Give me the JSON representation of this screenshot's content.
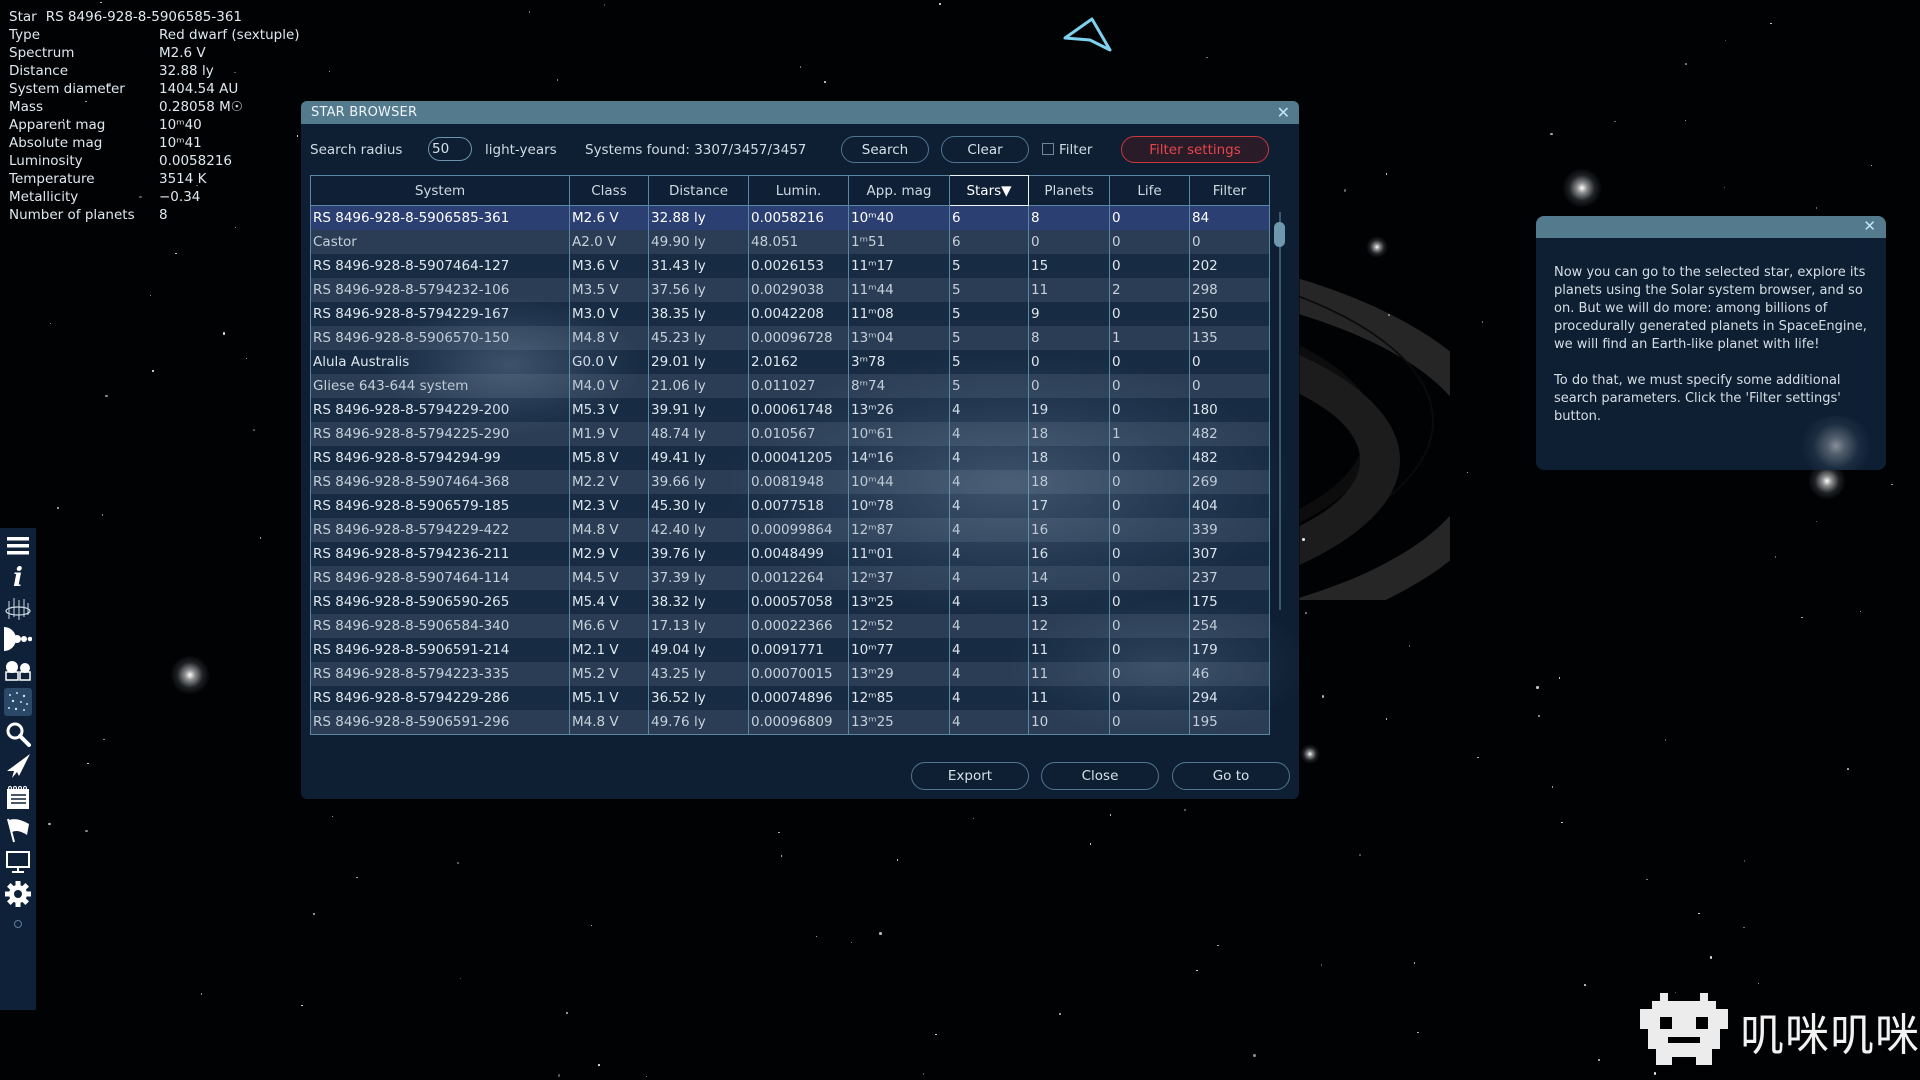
{
  "star_info": {
    "title_label": "Star",
    "title_value": "RS 8496-928-8-5906585-361",
    "rows": [
      {
        "label": "Type",
        "value": "Red dwarf (sextuple)"
      },
      {
        "label": "Spectrum",
        "value": "M2.6 V"
      },
      {
        "label": "Distance",
        "value": "32.88 ly"
      },
      {
        "label": "System diameter",
        "value": "1404.54 AU"
      },
      {
        "label": "Mass",
        "value": "0.28058 M☉"
      },
      {
        "label": "Apparent mag",
        "value": "10ᵐ40"
      },
      {
        "label": "Absolute mag",
        "value": "10ᵐ41"
      },
      {
        "label": "Luminosity",
        "value": "0.0058216"
      },
      {
        "label": "Temperature",
        "value": "3514 K"
      },
      {
        "label": "Metallicity",
        "value": "−0.34"
      },
      {
        "label": "Number of planets",
        "value": "8"
      }
    ]
  },
  "toolbar": {
    "icons": [
      "menu-icon",
      "info-icon",
      "galaxy-map-icon",
      "solar-system-icon",
      "observatory-icon",
      "star-browser-icon",
      "search-icon",
      "ship-icon",
      "notebook-icon",
      "flag-icon",
      "display-icon",
      "settings-icon"
    ],
    "active": "star-browser-icon"
  },
  "dialog": {
    "title": "STAR BROWSER",
    "close_glyph": "✕",
    "search_radius_label": "Search radius",
    "search_radius_value": "50",
    "radius_unit": "light-years",
    "systems_found": "Systems found: 3307/3457/3457",
    "search_button": "Search",
    "clear_button": "Clear",
    "filter_checkbox_label": "Filter",
    "filter_checked": false,
    "filter_settings_button": "Filter settings",
    "columns": [
      "System",
      "Class",
      "Distance",
      "Lumin.",
      "App. mag",
      "Stars▼",
      "Planets",
      "Life",
      "Filter"
    ],
    "sorted_column": "Stars",
    "selected_row": 0,
    "rows": [
      [
        "RS 8496-928-8-5906585-361",
        "M2.6 V",
        "32.88 ly",
        "0.0058216",
        "10ᵐ40",
        "6",
        "8",
        "0",
        "84"
      ],
      [
        "Castor",
        "A2.0 V",
        "49.90 ly",
        "48.051",
        "1ᵐ51",
        "6",
        "0",
        "0",
        "0"
      ],
      [
        "RS 8496-928-8-5907464-127",
        "M3.6 V",
        "31.43 ly",
        "0.0026153",
        "11ᵐ17",
        "5",
        "15",
        "0",
        "202"
      ],
      [
        "RS 8496-928-8-5794232-106",
        "M3.5 V",
        "37.56 ly",
        "0.0029038",
        "11ᵐ44",
        "5",
        "11",
        "2",
        "298"
      ],
      [
        "RS 8496-928-8-5794229-167",
        "M3.0 V",
        "38.35 ly",
        "0.0042208",
        "11ᵐ08",
        "5",
        "9",
        "0",
        "250"
      ],
      [
        "RS 8496-928-8-5906570-150",
        "M4.8 V",
        "45.23 ly",
        "0.00096728",
        "13ᵐ04",
        "5",
        "8",
        "1",
        "135"
      ],
      [
        "Alula Australis",
        "G0.0 V",
        "29.01 ly",
        "2.0162",
        "3ᵐ78",
        "5",
        "0",
        "0",
        "0"
      ],
      [
        "Gliese 643-644 system",
        "M4.0 V",
        "21.06 ly",
        "0.011027",
        "8ᵐ74",
        "5",
        "0",
        "0",
        "0"
      ],
      [
        "RS 8496-928-8-5794229-200",
        "M5.3 V",
        "39.91 ly",
        "0.00061748",
        "13ᵐ26",
        "4",
        "19",
        "0",
        "180"
      ],
      [
        "RS 8496-928-8-5794225-290",
        "M1.9 V",
        "48.74 ly",
        "0.010567",
        "10ᵐ61",
        "4",
        "18",
        "1",
        "482"
      ],
      [
        "RS 8496-928-8-5794294-99",
        "M5.8 V",
        "49.41 ly",
        "0.00041205",
        "14ᵐ16",
        "4",
        "18",
        "0",
        "482"
      ],
      [
        "RS 8496-928-8-5907464-368",
        "M2.2 V",
        "39.66 ly",
        "0.0081948",
        "10ᵐ44",
        "4",
        "18",
        "0",
        "269"
      ],
      [
        "RS 8496-928-8-5906579-185",
        "M2.3 V",
        "45.30 ly",
        "0.0077518",
        "10ᵐ78",
        "4",
        "17",
        "0",
        "404"
      ],
      [
        "RS 8496-928-8-5794229-422",
        "M4.8 V",
        "42.40 ly",
        "0.00099864",
        "12ᵐ87",
        "4",
        "16",
        "0",
        "339"
      ],
      [
        "RS 8496-928-8-5794236-211",
        "M2.9 V",
        "39.76 ly",
        "0.0048499",
        "11ᵐ01",
        "4",
        "16",
        "0",
        "307"
      ],
      [
        "RS 8496-928-8-5907464-114",
        "M4.5 V",
        "37.39 ly",
        "0.0012264",
        "12ᵐ37",
        "4",
        "14",
        "0",
        "237"
      ],
      [
        "RS 8496-928-8-5906590-265",
        "M5.4 V",
        "38.32 ly",
        "0.00057058",
        "13ᵐ25",
        "4",
        "13",
        "0",
        "175"
      ],
      [
        "RS 8496-928-8-5906584-340",
        "M6.6 V",
        "17.13 ly",
        "0.00022366",
        "12ᵐ52",
        "4",
        "12",
        "0",
        "254"
      ],
      [
        "RS 8496-928-8-5906591-214",
        "M2.1 V",
        "49.04 ly",
        "0.0091771",
        "10ᵐ77",
        "4",
        "11",
        "0",
        "179"
      ],
      [
        "RS 8496-928-8-5794223-335",
        "M5.2 V",
        "43.25 ly",
        "0.00070015",
        "13ᵐ29",
        "4",
        "11",
        "0",
        "46"
      ],
      [
        "RS 8496-928-8-5794229-286",
        "M5.1 V",
        "36.52 ly",
        "0.00074896",
        "12ᵐ85",
        "4",
        "11",
        "0",
        "294"
      ],
      [
        "RS 8496-928-8-5906591-296",
        "M4.8 V",
        "49.76 ly",
        "0.00096809",
        "13ᵐ25",
        "4",
        "10",
        "0",
        "195"
      ]
    ],
    "export_button": "Export",
    "close_button": "Close",
    "goto_button": "Go to"
  },
  "hint_panel": {
    "close_glyph": "✕",
    "paragraphs": [
      "Now you can go to the selected star, explore its planets using the Solar system browser, and so on. But we will do more: among billions of procedurally generated planets in SpaceEngine, we will find an Earth-like planet with life!",
      "To do that, we must specify some additional search parameters. Click the 'Filter settings' button."
    ]
  },
  "watermark": {
    "text": "叽咪叽咪"
  },
  "colors": {
    "panel_bg": "#0e1f33",
    "title_bar": "#547a8e",
    "selected_row": "#2b3f72",
    "accent_red": "#e4474c",
    "grid_line": "#5a88a4"
  }
}
